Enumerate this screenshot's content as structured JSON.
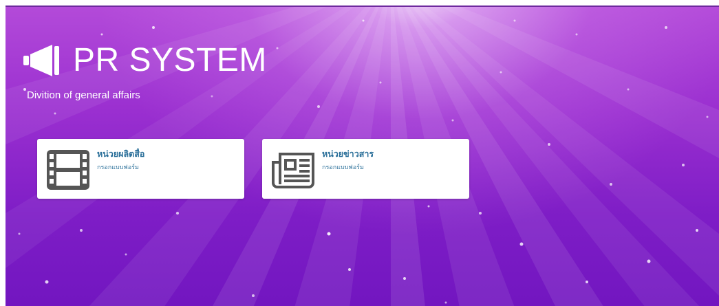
{
  "header": {
    "title": "PR SYSTEM",
    "subtitle": "Divition of general affairs",
    "logo_icon": "bullhorn-icon"
  },
  "cards": [
    {
      "title": "หน่วยผลิตสื่อ",
      "subtitle": "กรอกแบบฟอร์ม",
      "icon": "film-icon"
    },
    {
      "title": "หน่วยข่าวสาร",
      "subtitle": "กรอกแบบฟอร์ม",
      "icon": "newspaper-icon"
    }
  ],
  "colors": {
    "background_top": "#b34ad9",
    "background_bottom": "#7216c0",
    "card_background": "#ffffff",
    "card_text": "#2a6f99",
    "icon": "#555555"
  }
}
